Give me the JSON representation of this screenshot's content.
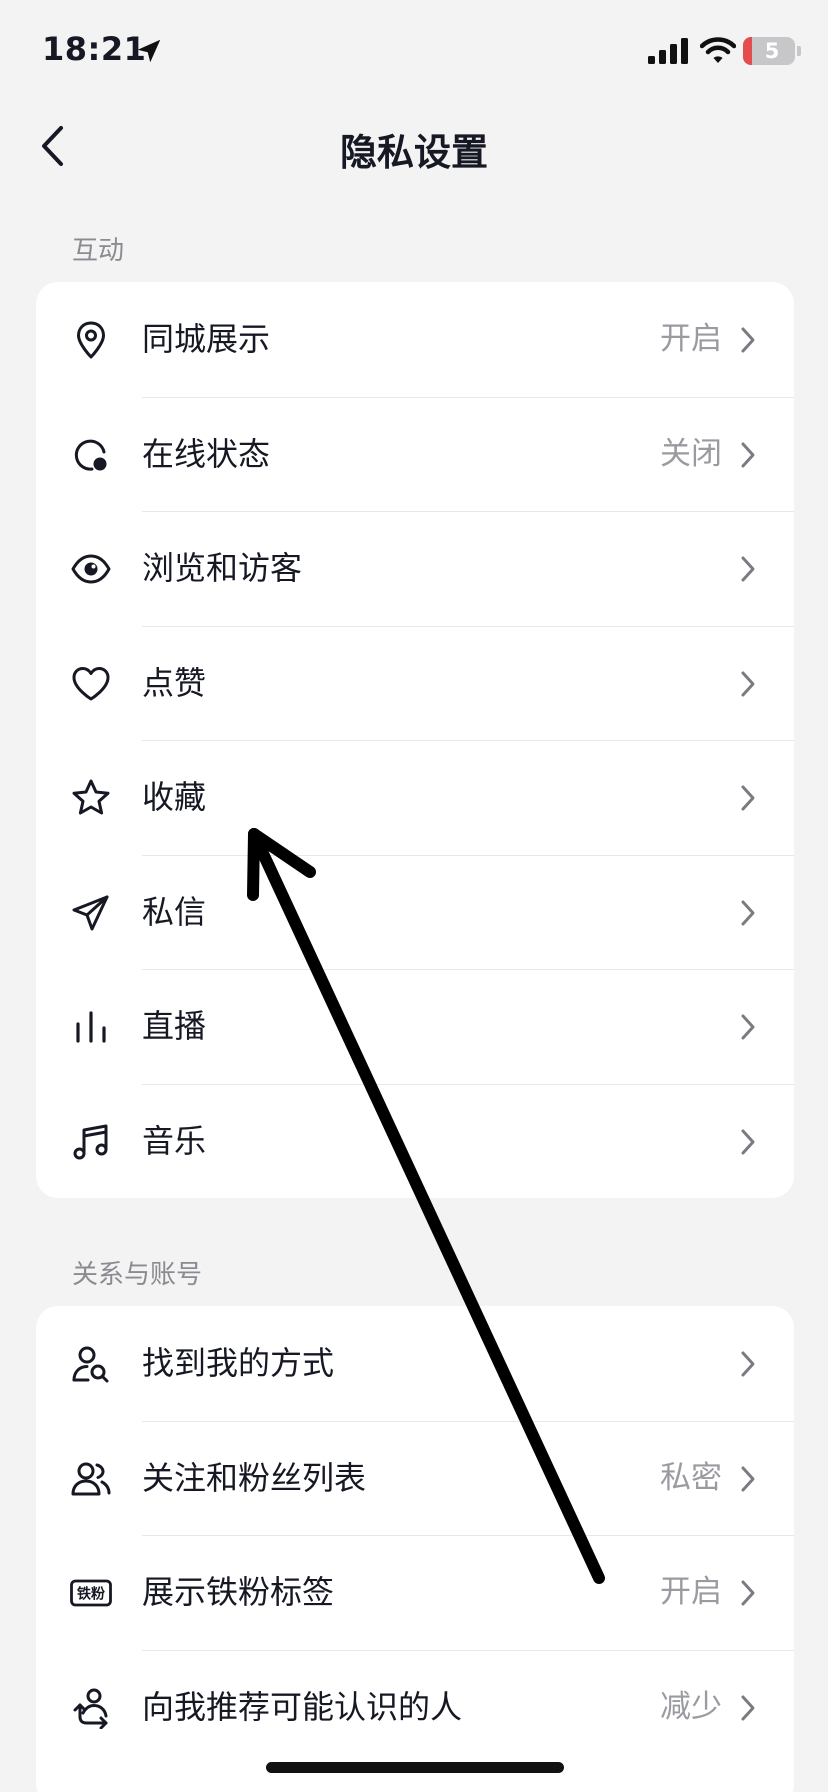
{
  "status": {
    "time": "18:21",
    "battery": "5"
  },
  "nav": {
    "title": "隐私设置"
  },
  "sections": [
    {
      "label": "互动",
      "items": [
        {
          "label": "同城展示",
          "value": "开启",
          "icon": "location-pin-icon"
        },
        {
          "label": "在线状态",
          "value": "关闭",
          "icon": "online-status-icon"
        },
        {
          "label": "浏览和访客",
          "value": "",
          "icon": "eye-icon"
        },
        {
          "label": "点赞",
          "value": "",
          "icon": "heart-icon"
        },
        {
          "label": "收藏",
          "value": "",
          "icon": "star-icon"
        },
        {
          "label": "私信",
          "value": "",
          "icon": "paper-plane-icon"
        },
        {
          "label": "直播",
          "value": "",
          "icon": "live-bars-icon"
        },
        {
          "label": "音乐",
          "value": "",
          "icon": "music-note-icon"
        }
      ]
    },
    {
      "label": "关系与账号",
      "items": [
        {
          "label": "找到我的方式",
          "value": "",
          "icon": "user-search-icon"
        },
        {
          "label": "关注和粉丝列表",
          "value": "私密",
          "icon": "users-icon"
        },
        {
          "label": "展示铁粉标签",
          "value": "开启",
          "icon": "iron-fan-badge-icon",
          "badge_text": "铁粉"
        },
        {
          "label": "向我推荐可能认识的人",
          "value": "减少",
          "icon": "recommend-people-icon"
        }
      ]
    }
  ],
  "colors": {
    "background": "#f3f3f4",
    "card": "#ffffff",
    "text": "#161823",
    "muted": "#9a9ba0",
    "battery_low": "#e44d4d"
  }
}
